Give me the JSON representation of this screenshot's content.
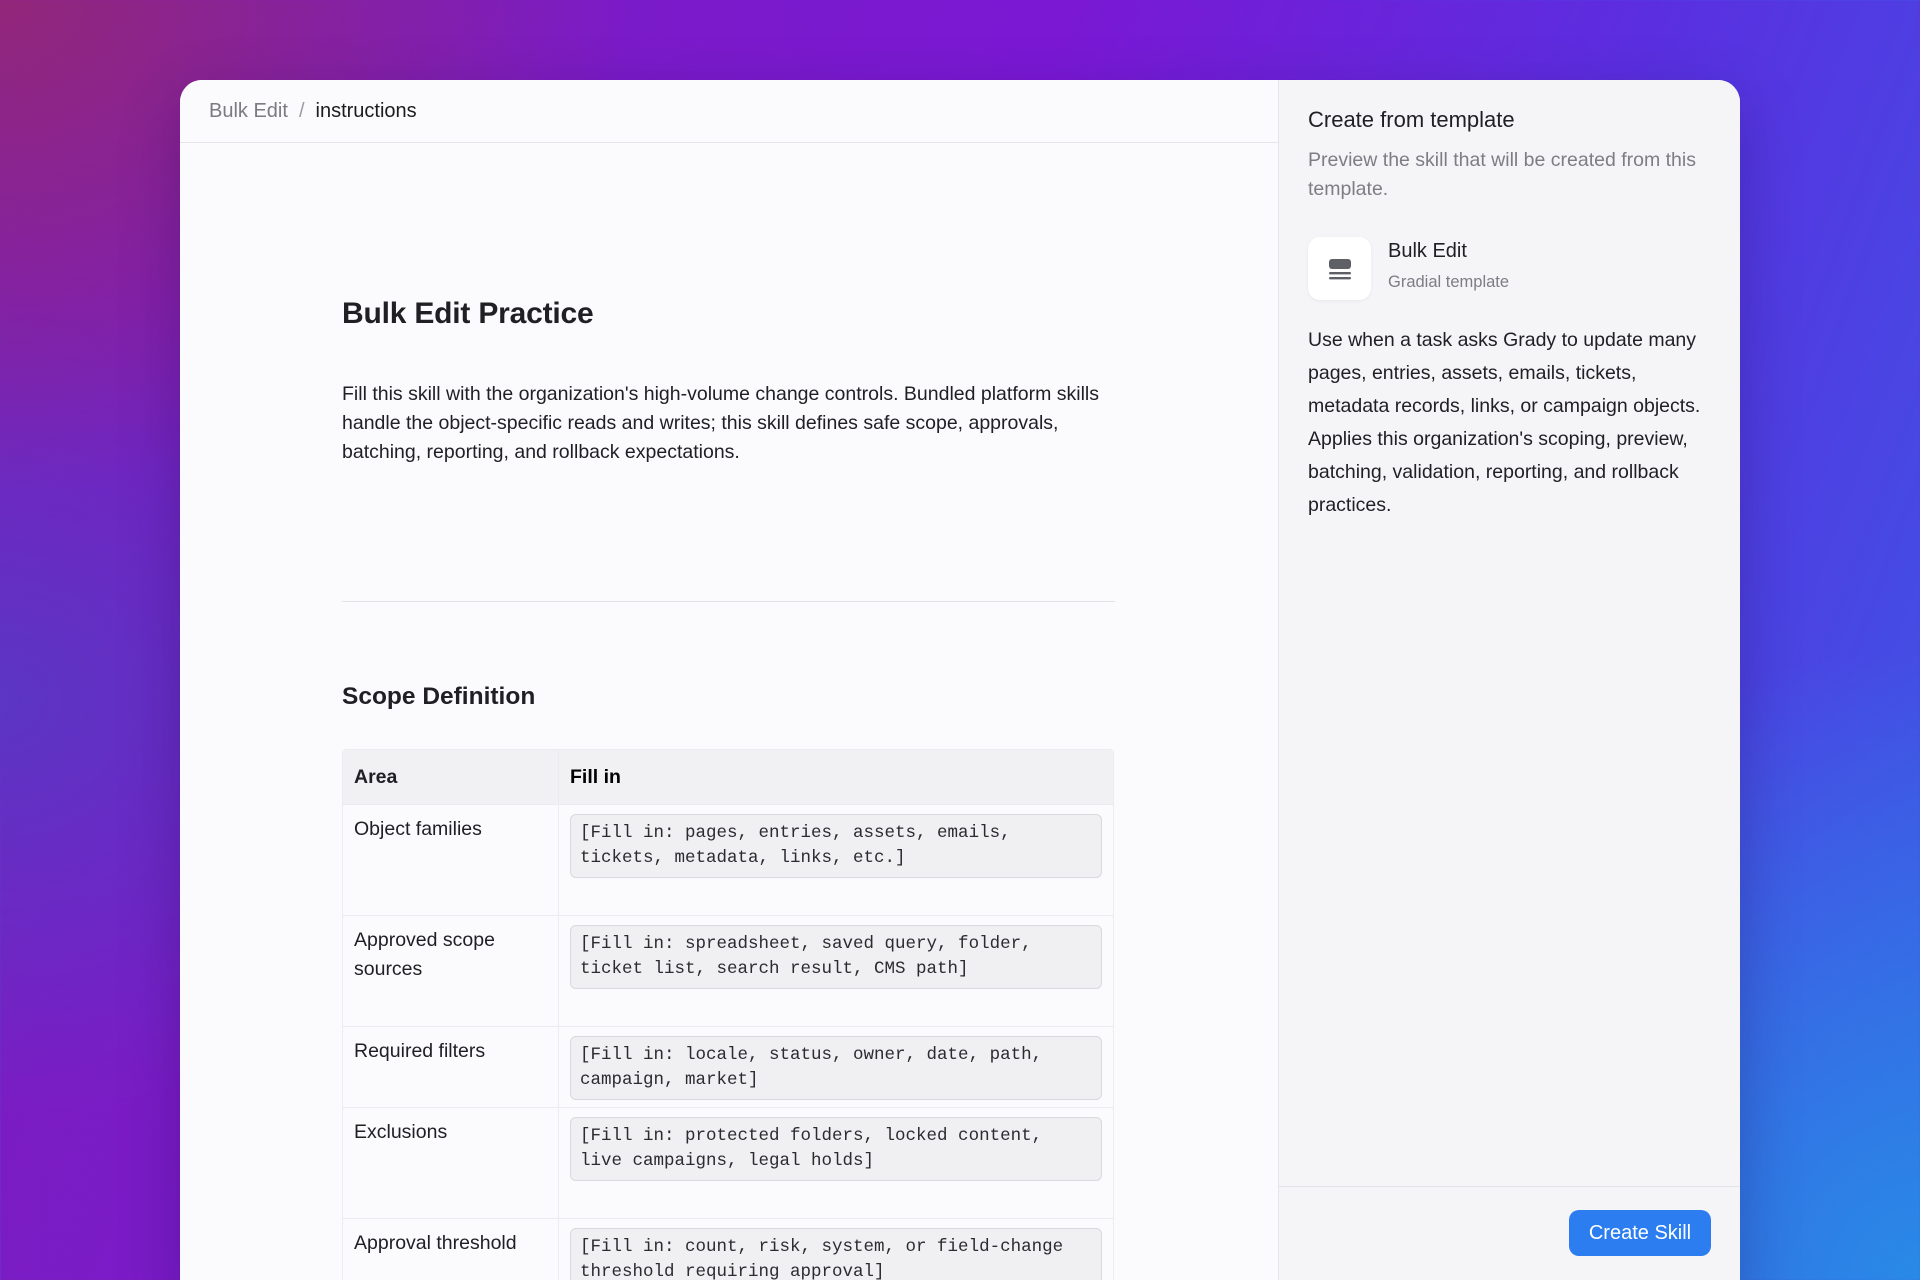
{
  "breadcrumb": {
    "root": "Bulk Edit",
    "separator": "/",
    "current": "instructions"
  },
  "document": {
    "title": "Bulk Edit Practice",
    "intro": "Fill this skill with the organization's high-volume change controls. Bundled platform skills handle the object-specific reads and writes; this skill defines safe scope, approvals, batching, reporting, and rollback expectations.",
    "section_title": "Scope Definition",
    "table": {
      "headers": [
        "Area",
        "Fill in"
      ],
      "rows": [
        {
          "area": "Object families",
          "fill": "[Fill in: pages, entries, assets, emails, tickets, metadata, links, etc.]"
        },
        {
          "area": "Approved scope sources",
          "fill": "[Fill in: spreadsheet, saved query, folder, ticket list, search result, CMS path]"
        },
        {
          "area": "Required filters",
          "fill": "[Fill in: locale, status, owner, date, path, campaign, market]"
        },
        {
          "area": "Exclusions",
          "fill": "[Fill in: protected folders, locked content, live campaigns, legal holds]"
        },
        {
          "area": "Approval threshold",
          "fill": "[Fill in: count, risk, system, or field-change threshold requiring approval]"
        }
      ]
    }
  },
  "side_panel": {
    "title": "Create from template",
    "subtitle": "Preview the skill that will be created from this template.",
    "template": {
      "icon": "stack-icon",
      "name": "Bulk Edit",
      "source": "Gradial template",
      "description": "Use when a task asks Grady to update many pages, entries, assets, emails, tickets, metadata records, links, or campaign objects. Applies this organization's scoping, preview, batching, validation, reporting, and rollback practices."
    },
    "create_button_label": "Create Skill"
  },
  "colors": {
    "accent": "#2b7df0",
    "text": "#1f1f24",
    "muted": "#7d7d84"
  }
}
